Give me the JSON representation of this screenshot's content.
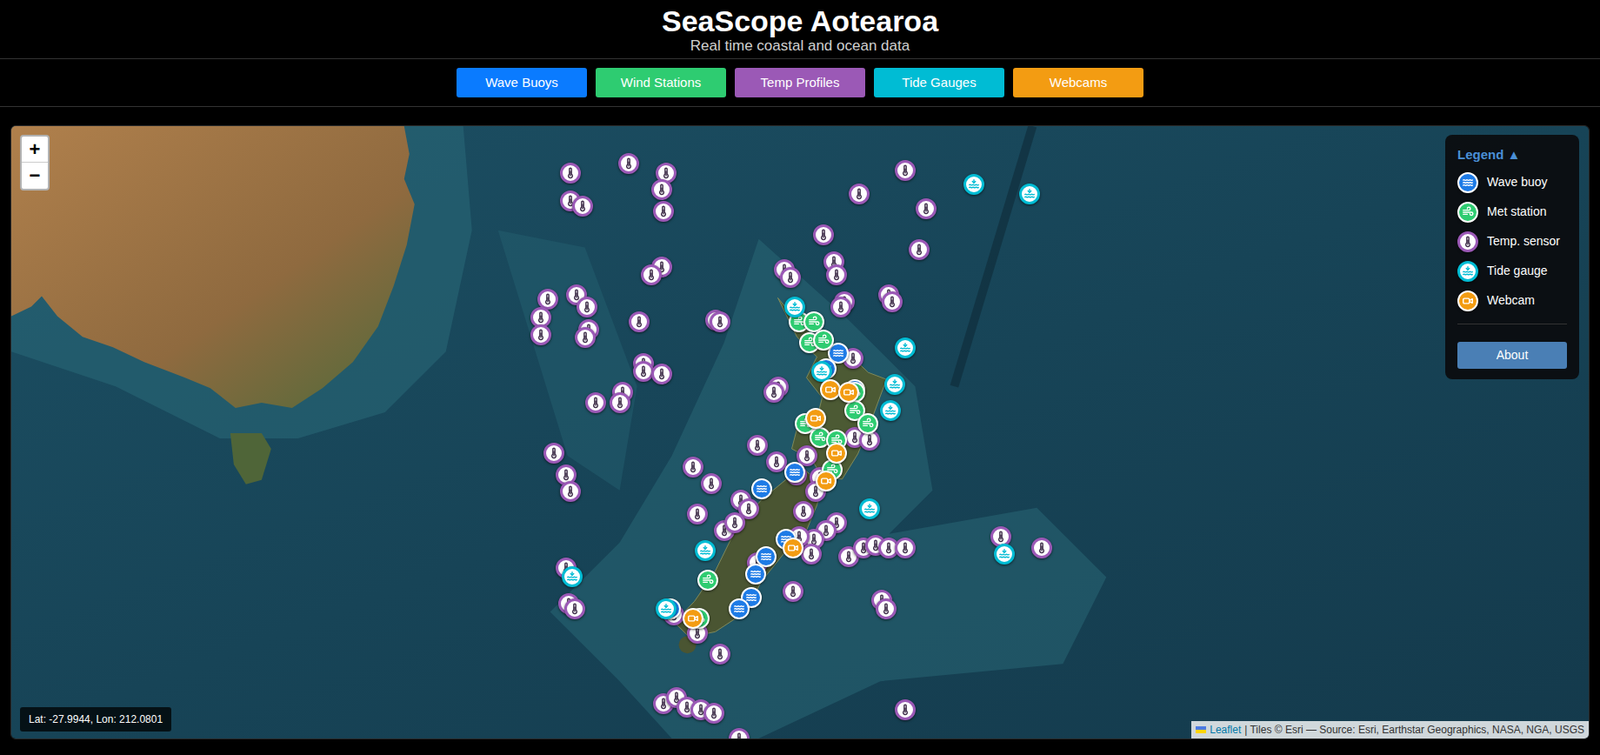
{
  "header": {
    "title": "SeaScope Aotearoa",
    "subtitle": "Real time coastal and ocean data"
  },
  "buttons": [
    {
      "label": "Wave Buoys",
      "color": "#0a7bff"
    },
    {
      "label": "Wind Stations",
      "color": "#2ecc71"
    },
    {
      "label": "Temp Profiles",
      "color": "#9b59b6"
    },
    {
      "label": "Tide Gauges",
      "color": "#00bcd4"
    },
    {
      "label": "Webcams",
      "color": "#f39c12"
    }
  ],
  "zoom": {
    "in": "+",
    "out": "−"
  },
  "legend": {
    "title": "Legend ▲",
    "items": [
      {
        "kind": "wave",
        "label": "Wave buoy",
        "color": "#1e7be6"
      },
      {
        "kind": "met",
        "label": "Met station",
        "color": "#2ecc71"
      },
      {
        "kind": "temp",
        "label": "Temp. sensor",
        "color": "#9b59b6"
      },
      {
        "kind": "tide",
        "label": "Tide gauge",
        "color": "#00bcd4"
      },
      {
        "kind": "webcam",
        "label": "Webcam",
        "color": "#f39c12"
      }
    ],
    "about": "About"
  },
  "coords": "Lat: -27.9944, Lon: 212.0801",
  "attribution": {
    "link": "Leaflet",
    "text": "| Tiles © Esri — Source: Esri, Earthstar Geographics, NASA, NGA, USGS"
  },
  "markers": [
    {
      "kind": "temp",
      "lat": -28.9,
      "lon": 162.3
    },
    {
      "kind": "temp",
      "lat": -28.5,
      "lon": 165.1
    },
    {
      "kind": "temp",
      "lat": -28.9,
      "lon": 166.9
    },
    {
      "kind": "temp",
      "lat": -29.6,
      "lon": 166.7
    },
    {
      "kind": "temp",
      "lat": -30.1,
      "lon": 162.3
    },
    {
      "kind": "temp",
      "lat": -30.3,
      "lon": 162.9
    },
    {
      "kind": "temp",
      "lat": -30.5,
      "lon": 166.8
    },
    {
      "kind": "temp",
      "lat": -28.8,
      "lon": 178.4
    },
    {
      "kind": "temp",
      "lat": -29.8,
      "lon": 176.2
    },
    {
      "kind": "temp",
      "lat": -30.4,
      "lon": 179.4
    },
    {
      "kind": "temp",
      "lat": -31.5,
      "lon": 174.5
    },
    {
      "kind": "temp",
      "lat": -32.1,
      "lon": 179.1
    },
    {
      "kind": "temp",
      "lat": -32.8,
      "lon": 166.7
    },
    {
      "kind": "temp",
      "lat": -33.1,
      "lon": 166.2
    },
    {
      "kind": "temp",
      "lat": -32.9,
      "lon": 172.6
    },
    {
      "kind": "temp",
      "lat": -33.2,
      "lon": 172.9
    },
    {
      "kind": "temp",
      "lat": -32.6,
      "lon": 175.0
    },
    {
      "kind": "temp",
      "lat": -33.1,
      "lon": 175.1
    },
    {
      "kind": "temp",
      "lat": -34.2,
      "lon": 175.5
    },
    {
      "kind": "temp",
      "lat": -34.4,
      "lon": 175.3
    },
    {
      "kind": "temp",
      "lat": -33.9,
      "lon": 177.6
    },
    {
      "kind": "temp",
      "lat": -34.2,
      "lon": 177.8
    },
    {
      "kind": "temp",
      "lat": -34.1,
      "lon": 161.2
    },
    {
      "kind": "temp",
      "lat": -33.9,
      "lon": 162.6
    },
    {
      "kind": "temp",
      "lat": -34.4,
      "lon": 163.1
    },
    {
      "kind": "temp",
      "lat": -34.8,
      "lon": 160.9
    },
    {
      "kind": "temp",
      "lat": -35.5,
      "lon": 160.9
    },
    {
      "kind": "temp",
      "lat": -35.3,
      "lon": 163.2
    },
    {
      "kind": "temp",
      "lat": -35.6,
      "lon": 163.0
    },
    {
      "kind": "temp",
      "lat": -35.0,
      "lon": 165.6
    },
    {
      "kind": "temp",
      "lat": -34.9,
      "lon": 169.3
    },
    {
      "kind": "temp",
      "lat": -35.0,
      "lon": 169.5
    },
    {
      "kind": "temp",
      "lat": -36.6,
      "lon": 165.8
    },
    {
      "kind": "temp",
      "lat": -36.9,
      "lon": 165.8
    },
    {
      "kind": "temp",
      "lat": -37.0,
      "lon": 166.7
    },
    {
      "kind": "temp",
      "lat": -37.5,
      "lon": 172.3
    },
    {
      "kind": "temp",
      "lat": -37.7,
      "lon": 172.1
    },
    {
      "kind": "temp",
      "lat": -37.7,
      "lon": 164.8
    },
    {
      "kind": "temp",
      "lat": -38.1,
      "lon": 164.7
    },
    {
      "kind": "temp",
      "lat": -38.1,
      "lon": 163.5
    },
    {
      "kind": "temp",
      "lat": -40.0,
      "lon": 161.5
    },
    {
      "kind": "temp",
      "lat": -40.8,
      "lon": 162.1
    },
    {
      "kind": "temp",
      "lat": -41.4,
      "lon": 162.3
    },
    {
      "kind": "temp",
      "lat": -39.7,
      "lon": 171.3
    },
    {
      "kind": "temp",
      "lat": -40.3,
      "lon": 172.2
    },
    {
      "kind": "temp",
      "lat": -40.1,
      "lon": 173.7
    },
    {
      "kind": "temp",
      "lat": -40.5,
      "lon": 168.2
    },
    {
      "kind": "temp",
      "lat": -41.1,
      "lon": 169.1
    },
    {
      "kind": "temp",
      "lat": -40.8,
      "lon": 173.2
    },
    {
      "kind": "temp",
      "lat": -40.9,
      "lon": 174.3
    },
    {
      "kind": "temp",
      "lat": -41.4,
      "lon": 174.1
    },
    {
      "kind": "temp",
      "lat": -42.1,
      "lon": 173.5
    },
    {
      "kind": "temp",
      "lat": -42.2,
      "lon": 168.4
    },
    {
      "kind": "temp",
      "lat": -42.8,
      "lon": 169.7
    },
    {
      "kind": "temp",
      "lat": -41.7,
      "lon": 170.5
    },
    {
      "kind": "temp",
      "lat": -42.0,
      "lon": 170.9
    },
    {
      "kind": "temp",
      "lat": -42.5,
      "lon": 175.1
    },
    {
      "kind": "temp",
      "lat": -42.8,
      "lon": 174.6
    },
    {
      "kind": "temp",
      "lat": -43.1,
      "lon": 174.0
    },
    {
      "kind": "temp",
      "lat": -43.0,
      "lon": 173.3
    },
    {
      "kind": "temp",
      "lat": -43.7,
      "lon": 175.7
    },
    {
      "kind": "temp",
      "lat": -43.4,
      "lon": 176.4
    },
    {
      "kind": "temp",
      "lat": -43.3,
      "lon": 177.0
    },
    {
      "kind": "temp",
      "lat": -43.4,
      "lon": 177.6
    },
    {
      "kind": "temp",
      "lat": -43.4,
      "lon": 178.4
    },
    {
      "kind": "temp",
      "lat": -43.6,
      "lon": 173.9
    },
    {
      "kind": "temp",
      "lat": -43.0,
      "lon": 183.0
    },
    {
      "kind": "temp",
      "lat": -43.4,
      "lon": 185.0
    },
    {
      "kind": "temp",
      "lat": -44.1,
      "lon": 162.1
    },
    {
      "kind": "temp",
      "lat": -45.3,
      "lon": 162.2
    },
    {
      "kind": "temp",
      "lat": -45.5,
      "lon": 162.5
    },
    {
      "kind": "temp",
      "lat": -44.9,
      "lon": 173.0
    },
    {
      "kind": "temp",
      "lat": -45.2,
      "lon": 177.3
    },
    {
      "kind": "temp",
      "lat": -45.5,
      "lon": 177.5
    },
    {
      "kind": "temp",
      "lat": -45.7,
      "lon": 167.3
    },
    {
      "kind": "temp",
      "lat": -46.3,
      "lon": 168.4
    },
    {
      "kind": "temp",
      "lat": -47.0,
      "lon": 169.5
    },
    {
      "kind": "temp",
      "lat": -48.6,
      "lon": 166.8
    },
    {
      "kind": "temp",
      "lat": -48.4,
      "lon": 167.4
    },
    {
      "kind": "temp",
      "lat": -48.7,
      "lon": 167.9
    },
    {
      "kind": "temp",
      "lat": -48.8,
      "lon": 168.6
    },
    {
      "kind": "temp",
      "lat": -48.9,
      "lon": 169.2
    },
    {
      "kind": "temp",
      "lat": -48.8,
      "lon": 178.4
    },
    {
      "kind": "temp",
      "lat": -49.7,
      "lon": 170.4
    },
    {
      "kind": "temp",
      "lat": -36.4,
      "lon": 175.9
    },
    {
      "kind": "temp",
      "lat": -39.4,
      "lon": 176.0
    },
    {
      "kind": "temp",
      "lat": -39.5,
      "lon": 176.7
    },
    {
      "kind": "temp",
      "lat": -43.9,
      "lon": 171.3
    },
    {
      "kind": "temp",
      "lat": -42.5,
      "lon": 170.2
    },
    {
      "kind": "wave",
      "lat": -36.2,
      "lon": 175.2
    },
    {
      "kind": "wave",
      "lat": -36.8,
      "lon": 174.6
    },
    {
      "kind": "wave",
      "lat": -37.6,
      "lon": 176.0
    },
    {
      "kind": "wave",
      "lat": -40.7,
      "lon": 173.1
    },
    {
      "kind": "wave",
      "lat": -41.3,
      "lon": 171.5
    },
    {
      "kind": "wave",
      "lat": -43.7,
      "lon": 171.7
    },
    {
      "kind": "wave",
      "lat": -43.1,
      "lon": 172.7
    },
    {
      "kind": "wave",
      "lat": -44.3,
      "lon": 171.2
    },
    {
      "kind": "wave",
      "lat": -45.1,
      "lon": 171.0
    },
    {
      "kind": "wave",
      "lat": -45.5,
      "lon": 170.4
    },
    {
      "kind": "wave",
      "lat": -45.5,
      "lon": 167.1
    },
    {
      "kind": "met",
      "lat": -35.0,
      "lon": 173.3
    },
    {
      "kind": "met",
      "lat": -35.0,
      "lon": 174.0
    },
    {
      "kind": "met",
      "lat": -35.8,
      "lon": 173.8
    },
    {
      "kind": "met",
      "lat": -35.7,
      "lon": 174.5
    },
    {
      "kind": "met",
      "lat": -37.7,
      "lon": 176.0
    },
    {
      "kind": "met",
      "lat": -38.4,
      "lon": 176.0
    },
    {
      "kind": "met",
      "lat": -38.9,
      "lon": 173.6
    },
    {
      "kind": "met",
      "lat": -39.4,
      "lon": 174.3
    },
    {
      "kind": "met",
      "lat": -39.5,
      "lon": 175.1
    },
    {
      "kind": "met",
      "lat": -38.9,
      "lon": 176.6
    },
    {
      "kind": "met",
      "lat": -40.6,
      "lon": 174.9
    },
    {
      "kind": "met",
      "lat": -44.5,
      "lon": 168.9
    },
    {
      "kind": "met",
      "lat": -45.8,
      "lon": 168.5
    },
    {
      "kind": "tide",
      "lat": -29.4,
      "lon": 181.7
    },
    {
      "kind": "tide",
      "lat": -29.8,
      "lon": 184.4
    },
    {
      "kind": "tide",
      "lat": -34.4,
      "lon": 173.1
    },
    {
      "kind": "tide",
      "lat": -36.0,
      "lon": 178.4
    },
    {
      "kind": "tide",
      "lat": -37.4,
      "lon": 177.9
    },
    {
      "kind": "tide",
      "lat": -38.4,
      "lon": 177.7
    },
    {
      "kind": "tide",
      "lat": -36.9,
      "lon": 174.4
    },
    {
      "kind": "tide",
      "lat": -42.0,
      "lon": 176.7
    },
    {
      "kind": "tide",
      "lat": -43.6,
      "lon": 183.2
    },
    {
      "kind": "tide",
      "lat": -43.5,
      "lon": 168.8
    },
    {
      "kind": "tide",
      "lat": -44.4,
      "lon": 162.4
    },
    {
      "kind": "tide",
      "lat": -45.5,
      "lon": 166.9
    },
    {
      "kind": "webcam",
      "lat": -37.6,
      "lon": 174.8
    },
    {
      "kind": "webcam",
      "lat": -37.7,
      "lon": 175.7
    },
    {
      "kind": "webcam",
      "lat": -38.7,
      "lon": 174.1
    },
    {
      "kind": "webcam",
      "lat": -40.0,
      "lon": 175.1
    },
    {
      "kind": "webcam",
      "lat": -41.0,
      "lon": 174.6
    },
    {
      "kind": "webcam",
      "lat": -43.4,
      "lon": 173.0
    },
    {
      "kind": "webcam",
      "lat": -45.8,
      "lon": 168.2
    }
  ]
}
